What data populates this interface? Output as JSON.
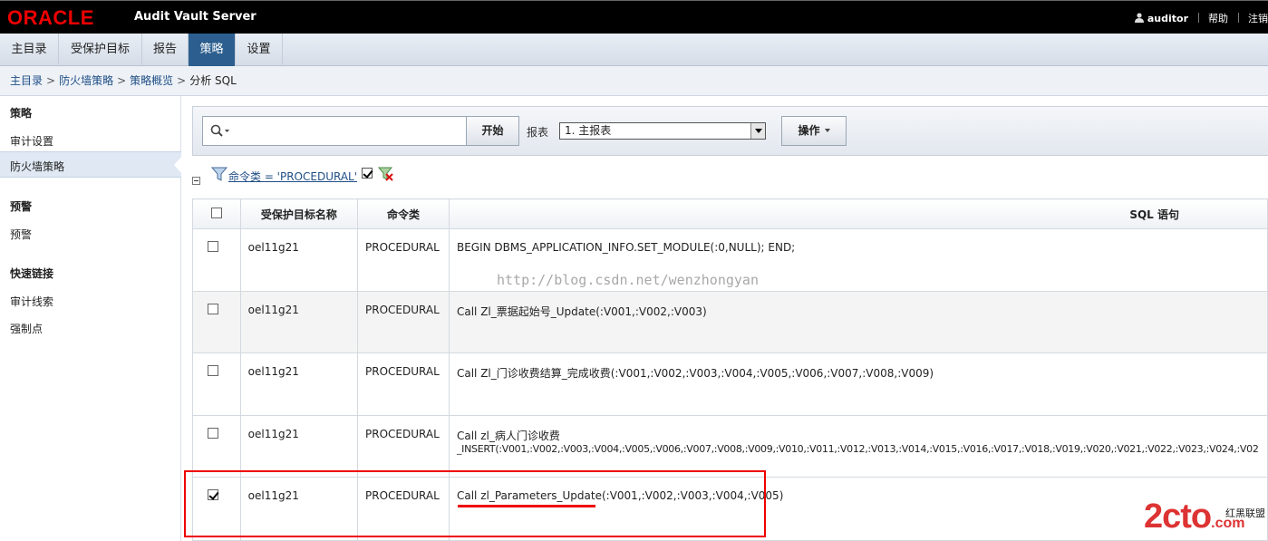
{
  "header": {
    "logo": "ORACLE",
    "app_title": "Audit Vault Server",
    "user": "auditor",
    "help": "帮助",
    "logout": "注销"
  },
  "tabs": [
    {
      "label": "主目录",
      "active": false
    },
    {
      "label": "受保护目标",
      "active": false
    },
    {
      "label": "报告",
      "active": false
    },
    {
      "label": "策略",
      "active": true
    },
    {
      "label": "设置",
      "active": false
    }
  ],
  "breadcrumb": [
    "主目录",
    "防火墙策略",
    "策略概览",
    "分析 SQL"
  ],
  "sidebar": {
    "sections": [
      {
        "title": "策略",
        "items": [
          "审计设置",
          "防火墙策略"
        ]
      },
      {
        "title": "预警",
        "items": [
          "预警"
        ]
      },
      {
        "title": "快速链接",
        "items": [
          "审计线索",
          "强制点"
        ]
      }
    ],
    "selected": "防火墙策略"
  },
  "toolbar": {
    "search_value": "",
    "go_label": "开始",
    "report_label": "报表",
    "report_selected": "1. 主报表",
    "actions_label": "操作"
  },
  "filter": {
    "text": "命令类 = 'PROCEDURAL'"
  },
  "table": {
    "columns": [
      "受保护目标名称",
      "命令类",
      "SQL 语句"
    ],
    "rows": [
      {
        "checked": false,
        "target": "oel11g21",
        "command": "PROCEDURAL",
        "sql": "BEGIN DBMS_APPLICATION_INFO.SET_MODULE(:0,NULL); END;",
        "sql2": ""
      },
      {
        "checked": false,
        "target": "oel11g21",
        "command": "PROCEDURAL",
        "sql": "Call Zl_票据起始号_Update(:V001,:V002,:V003)",
        "sql2": ""
      },
      {
        "checked": false,
        "target": "oel11g21",
        "command": "PROCEDURAL",
        "sql": "Call Zl_门诊收费结算_完成收费(:V001,:V002,:V003,:V004,:V005,:V006,:V007,:V008,:V009)",
        "sql2": ""
      },
      {
        "checked": false,
        "target": "oel11g21",
        "command": "PROCEDURAL",
        "sql": "Call zl_病人门诊收费",
        "sql2": "_INSERT(:V001,:V002,:V003,:V004,:V005,:V006,:V007,:V008,:V009,:V010,:V011,:V012,:V013,:V014,:V015,:V016,:V017,:V018,:V019,:V020,:V021,:V022,:V023,:V024,:V02"
      },
      {
        "checked": true,
        "target": "oel11g21",
        "command": "PROCEDURAL",
        "sql": "Call zl_Parameters_Update(:V001,:V002,:V003,:V004,:V005)",
        "sql2": ""
      }
    ]
  },
  "watermark": "http://blog.csdn.net/wenzhongyan",
  "corner_brand": {
    "main": "2cto",
    "suffix": ".com",
    "sub": "红黑联盟"
  }
}
